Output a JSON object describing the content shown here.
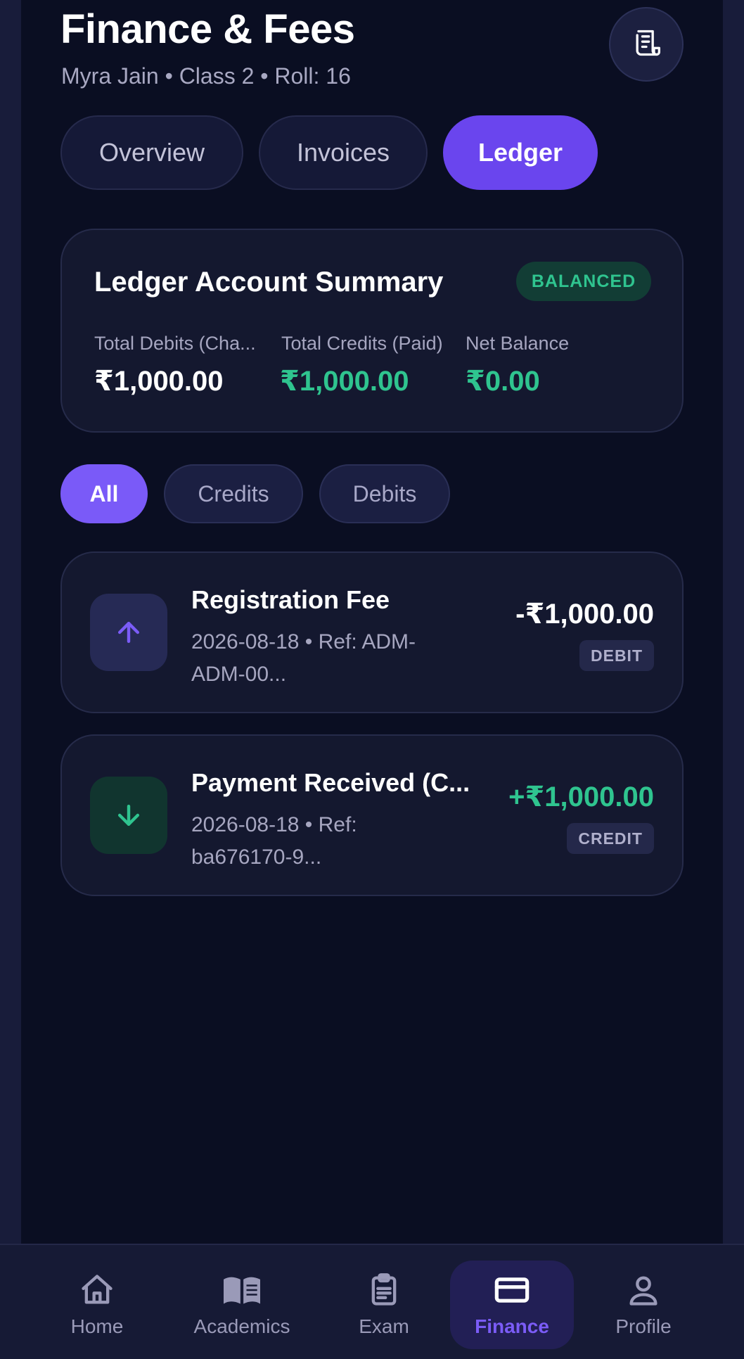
{
  "header": {
    "title": "Finance & Fees",
    "subtitle": "Myra Jain • Class 2 • Roll: 16",
    "action_icon": "receipt-icon"
  },
  "tabs": [
    {
      "label": "Overview",
      "active": false
    },
    {
      "label": "Invoices",
      "active": false
    },
    {
      "label": "Ledger",
      "active": true
    }
  ],
  "summary": {
    "title": "Ledger Account Summary",
    "status": "BALANCED",
    "stats": [
      {
        "label": "Total Debits (Cha...",
        "value": "₹1,000.00",
        "color": "#ffffff"
      },
      {
        "label": "Total Credits (Paid)",
        "value": "₹1,000.00",
        "color": "#2fc48f"
      },
      {
        "label": "Net Balance",
        "value": "₹0.00",
        "color": "#2fc48f"
      }
    ]
  },
  "filters": [
    {
      "label": "All",
      "active": true
    },
    {
      "label": "Credits",
      "active": false
    },
    {
      "label": "Debits",
      "active": false
    }
  ],
  "transactions": [
    {
      "title": "Registration Fee",
      "meta": "2026-08-18 • Ref: ADM-ADM-00...",
      "amount": "-₹1,000.00",
      "type": "DEBIT",
      "icon": "arrow-up-icon",
      "amount_color": "#ffffff"
    },
    {
      "title": "Payment Received (C...",
      "meta": "2026-08-18 • Ref: ba676170-9...",
      "amount": "+₹1,000.00",
      "type": "CREDIT",
      "icon": "arrow-down-icon",
      "amount_color": "#2fc48f"
    }
  ],
  "nav": [
    {
      "label": "Home",
      "icon": "home-icon",
      "active": false
    },
    {
      "label": "Academics",
      "icon": "book-icon",
      "active": false
    },
    {
      "label": "Exam",
      "icon": "clipboard-icon",
      "active": false
    },
    {
      "label": "Finance",
      "icon": "card-icon",
      "active": true
    },
    {
      "label": "Profile",
      "icon": "user-icon",
      "active": false
    }
  ],
  "colors": {
    "accent": "#6a45ee",
    "success": "#2fc48f",
    "background": "#0a0e22"
  }
}
